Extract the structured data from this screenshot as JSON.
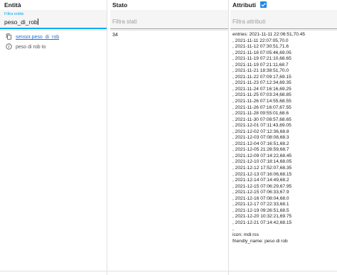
{
  "headers": {
    "entity": "Entità",
    "state": "Stato",
    "attributes": "Attributi"
  },
  "attributes_checkbox_checked": true,
  "filters": {
    "entity_label": "Filtra entità",
    "entity_value": "peso_di_rob",
    "state_placeholder": "Filtra stati",
    "attributes_placeholder": "Filtra attributi"
  },
  "entity_row": {
    "entity_id": "sensor.peso_di_rob",
    "friendly": "peso di rob to",
    "state": "34",
    "attributes_lines": [
      "entries: 2021-11-11 22:06:51,70.45",
      ", 2021-11-11 22:07:05,70.0",
      ", 2021-11-12 07:30:51,71.6",
      ", 2021-11-18 07:05:46,69.05",
      ", 2021-11-19 07:21:10,68.65",
      ", 2021-11-19 07:21:11,68.7",
      ", 2021-11-21 18:38:51,70.0",
      ", 2021-11-22 07:09:17,69.15",
      ", 2021-11-23 07:12:34,69.35",
      ", 2021-11-24 07:16:16,69.25",
      ", 2021-11-25 07:03:24,68.85",
      ", 2021-11-26 07:14:55,68.55",
      ", 2021-11-26 07:16:07,67.55",
      ", 2021-11-28 09:55:01,68.6",
      ", 2021-11-30 07:08:57,68.65",
      ", 2021-12-01 07:11:43,69.05",
      ", 2021-12-02 07:12:36,68.8",
      ", 2021-12-03 07:08:08,68.3",
      ", 2021-12-04 07:16:51,68.2",
      ", 2021-12-05 21:28:59,68.7",
      ", 2021-12-09 07:14:22,68.45",
      ", 2021-12-10 07:18:14,68.05",
      ", 2021-12-12 17:52:07,68.35",
      ", 2021-12-13 07:16:06,68.15",
      ", 2021-12-14 07:14:49,68.2",
      ", 2021-12-15 07:06:29,67.95",
      ", 2021-12-15 07:06:33,67.9",
      ", 2021-12-16 07:08:04,68.0",
      ", 2021-12-17 07:22:33,68.1",
      ", 2021-12-19 09:26:51,68.5",
      ", 2021-12-20 10:32:21,69.75",
      ", 2021-12-21 07:14:42,68.15",
      ",",
      "icon: mdi:rss",
      "friendly_name: peso di rob"
    ]
  },
  "colors": {
    "accent": "#03a9f4",
    "checkbox": "#1e88e5",
    "link": "#1e6fd0"
  },
  "icons": {
    "entity_icon": "copy-icon",
    "info_icon": "info-icon",
    "checkbox_icon": "checkbox-checked-icon"
  }
}
